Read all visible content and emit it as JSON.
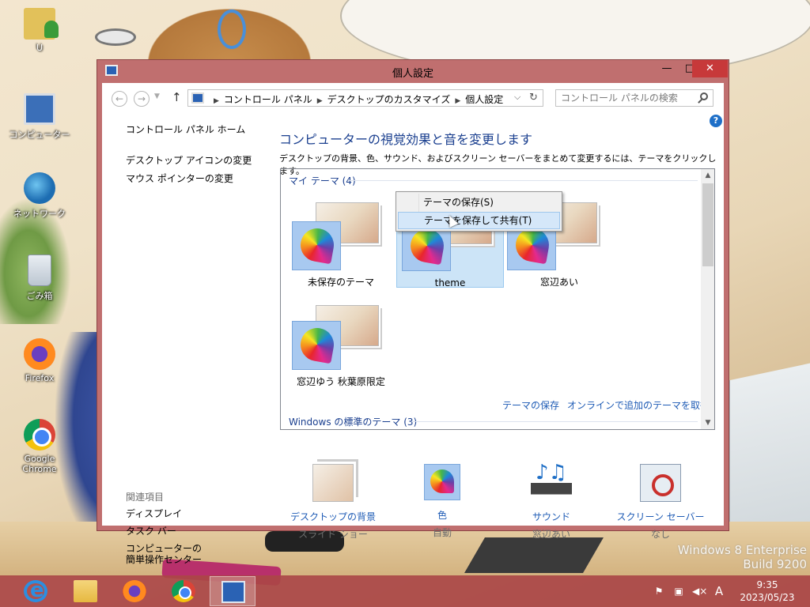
{
  "desktop": {
    "icons": [
      {
        "label": "U",
        "icon": "user-folder-icon"
      },
      {
        "label": "コンピューター",
        "icon": "computer-icon"
      },
      {
        "label": "ネットワーク",
        "icon": "network-icon"
      },
      {
        "label": "ごみ箱",
        "icon": "recycle-bin-icon"
      },
      {
        "label": "Firefox",
        "icon": "firefox-icon"
      },
      {
        "label": "Google Chrome",
        "icon": "chrome-icon"
      }
    ]
  },
  "window": {
    "title": "個人設定",
    "controls": {
      "minimize": "—",
      "maximize": "□",
      "close": "✕"
    },
    "nav": {
      "back": "←",
      "forward": "→",
      "up": "↑",
      "breadcrumbs": [
        "コントロール パネル",
        "デスクトップのカスタマイズ",
        "個人設定"
      ],
      "refresh": "↻",
      "search_placeholder": "コントロール パネルの検索"
    },
    "left_pane": {
      "home": "コントロール パネル ホーム",
      "links": [
        "デスクトップ アイコンの変更",
        "マウス ポインターの変更"
      ],
      "related_heading": "関連項目",
      "related": [
        "ディスプレイ",
        "タスク バー",
        "コンピューターの\n簡単操作センター"
      ]
    },
    "help": "?",
    "main": {
      "title": "コンピューターの視覚効果と音を変更します",
      "description": "デスクトップの背景、色、サウンド、およびスクリーン セーバーをまとめて変更するには、テーマをクリックします。",
      "my_themes_heading": "マイ テーマ (4)",
      "themes": [
        {
          "label": "未保存のテーマ",
          "selected": false
        },
        {
          "label": "theme",
          "selected": true
        },
        {
          "label": "窓辺あい",
          "selected": false
        },
        {
          "label": "窓辺ゆう 秋葉原限定",
          "selected": false
        }
      ],
      "save_theme_link": "テーマの保存",
      "online_link": "オンラインで追加のテーマを取得",
      "standard_heading": "Windows の標準のテーマ (3)"
    },
    "context_menu": {
      "items": [
        "テーマの保存(S)",
        "テーマを保存して共有(T)"
      ],
      "highlighted_index": 1
    },
    "bottom": [
      {
        "label": "デスクトップの背景",
        "sub": "スライド ショー",
        "icon": "desktop-background-icon"
      },
      {
        "label": "色",
        "sub": "自動",
        "icon": "color-icon"
      },
      {
        "label": "サウンド",
        "sub": "窓辺あい",
        "icon": "sound-icon"
      },
      {
        "label": "スクリーン セーバー",
        "sub": "なし",
        "icon": "screen-saver-icon"
      }
    ]
  },
  "taskbar": {
    "apps": [
      {
        "name": "Internet Explorer",
        "icon": "ie-icon",
        "active": false
      },
      {
        "name": "File Explorer",
        "icon": "folder-icon",
        "active": false
      },
      {
        "name": "Firefox",
        "icon": "firefox-icon",
        "active": false
      },
      {
        "name": "Google Chrome",
        "icon": "chrome-icon",
        "active": false
      },
      {
        "name": "Control Panel",
        "icon": "control-panel-icon",
        "active": true
      }
    ],
    "tray": {
      "ime": "A",
      "time": "9:35",
      "date": "2023/05/23"
    }
  },
  "watermark": {
    "line1": "Windows 8 Enterprise",
    "line2": "Build 9200"
  },
  "colors": {
    "window_frame": "#c06f6f",
    "close_button": "#c7393a",
    "link_blue": "#1e5bb5",
    "heading_blue": "#1a3f8f",
    "selection": "#cce4f7"
  }
}
